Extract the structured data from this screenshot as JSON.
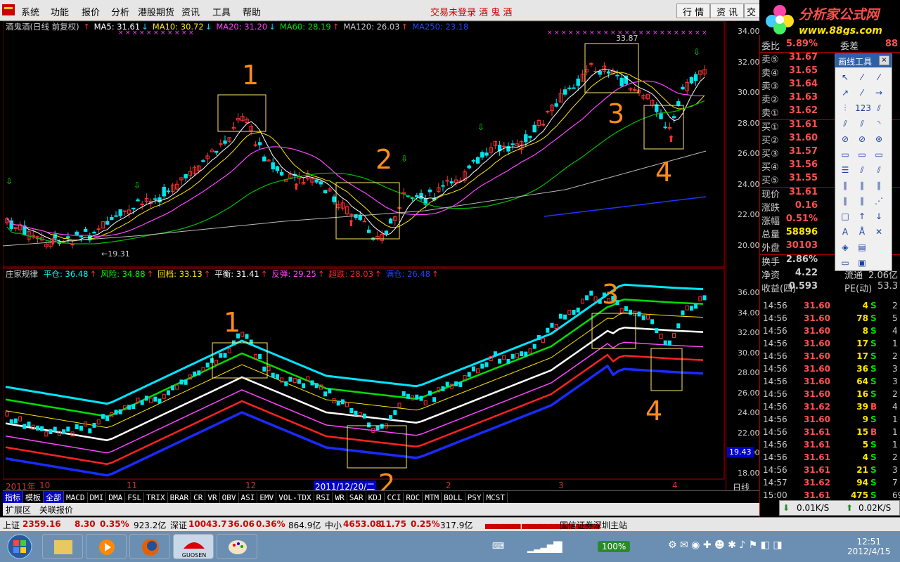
{
  "menubar": {
    "items": [
      "系统",
      "功能",
      "报价",
      "分析",
      "港股期货",
      "资讯",
      "工具",
      "帮助"
    ],
    "notice": "交易未登录  酒 鬼 酒",
    "tabs": [
      "行 情",
      "资 讯",
      "交"
    ]
  },
  "brand": {
    "name": "分析家公式网",
    "url": "www.88gs.com"
  },
  "main_chart": {
    "legend": {
      "stock": "酒鬼酒(日线 前复权)",
      "ma": [
        {
          "label": "MA5: 31.61",
          "color": "#ffffff",
          "arrow": "↓"
        },
        {
          "label": "MA10: 30.72",
          "color": "#ffe600",
          "arrow": "↓"
        },
        {
          "label": "MA20: 31.20",
          "color": "#ff44ff",
          "arrow": "↓"
        },
        {
          "label": "MA60: 28.19",
          "color": "#00dd00",
          "arrow": "↑"
        },
        {
          "label": "MA120: 26.03",
          "color": "#cccccc",
          "arrow": "↑"
        },
        {
          "label": "MA250: 23.18",
          "color": "#2244ff",
          "arrow": ""
        }
      ]
    },
    "price_axis": [
      "34.00",
      "32.00",
      "30.00",
      "28.00",
      "26.00",
      "24.00",
      "22.00",
      "20.00"
    ],
    "annotations": [
      "1",
      "2",
      "3",
      "4"
    ],
    "labels": {
      "high": "33.87",
      "low": "19.31"
    }
  },
  "sub_chart": {
    "legend": [
      {
        "label": "庄家规律",
        "color": "#cccccc"
      },
      {
        "label": "平仓: 36.48",
        "color": "#00ffff",
        "arrow": "↑"
      },
      {
        "label": "风险: 34.88",
        "color": "#00ff00",
        "arrow": "↑"
      },
      {
        "label": "回档: 33.13",
        "color": "#ffe600",
        "arrow": "↑"
      },
      {
        "label": "平衡: 31.41",
        "color": "#ffffff",
        "arrow": "↑"
      },
      {
        "label": "反弹: 29.25",
        "color": "#ff44ff",
        "arrow": "↑"
      },
      {
        "label": "超跌: 28.03",
        "color": "#ff2222",
        "arrow": "↑"
      },
      {
        "label": "满仓: 26.48",
        "color": "#2244ff",
        "arrow": "↑"
      }
    ],
    "price_axis": [
      "36.00",
      "34.00",
      "32.00",
      "30.00",
      "28.00",
      "26.00",
      "24.00",
      "22.00",
      "20.00",
      "18.00"
    ],
    "price_box": "19.43",
    "annotations": [
      "1",
      "2",
      "3",
      "4"
    ]
  },
  "time_axis": {
    "labels": [
      "2011年",
      "10",
      "11",
      "12",
      "2011/12/20/二",
      "2",
      "3",
      "4"
    ],
    "period": "日线"
  },
  "indicator_tabs": [
    "指标",
    "模板",
    "全部",
    "MACD",
    "DMI",
    "DMA",
    "FSL",
    "TRIX",
    "BRAR",
    "CR",
    "VR",
    "OBV",
    "ASI",
    "EMV",
    "VOL-TDX",
    "RSI",
    "WR",
    "SAR",
    "KDJ",
    "CCI",
    "ROC",
    "MTM",
    "BOLL",
    "PSY",
    "MCST"
  ],
  "sub_tabs": [
    "扩展区",
    "关联报价"
  ],
  "quote": {
    "weibi": {
      "label": "委比",
      "value": "5.89%",
      "extra": "委差",
      "extra_val": "88"
    },
    "sell": [
      {
        "label": "卖⑤",
        "price": "31.67"
      },
      {
        "label": "卖④",
        "price": "31.65"
      },
      {
        "label": "卖③",
        "price": "31.64"
      },
      {
        "label": "卖②",
        "price": "31.63"
      },
      {
        "label": "卖①",
        "price": "31.62"
      }
    ],
    "buy": [
      {
        "label": "买①",
        "price": "31.61"
      },
      {
        "label": "买②",
        "price": "31.60"
      },
      {
        "label": "买③",
        "price": "31.57"
      },
      {
        "label": "买④",
        "price": "31.56"
      },
      {
        "label": "买⑤",
        "price": "31.55"
      }
    ],
    "stats": [
      {
        "label": "现价",
        "value": "31.61",
        "color": "#ff5050"
      },
      {
        "label": "涨跌",
        "value": "0.16",
        "color": "#ff5050"
      },
      {
        "label": "涨幅",
        "value": "0.51%",
        "color": "#ff5050"
      },
      {
        "label": "总量",
        "value": "58896",
        "color": "#ffe600"
      },
      {
        "label": "外盘",
        "value": "30103",
        "color": "#ff5050"
      }
    ],
    "stats2": [
      {
        "label": "换手",
        "value": "2.86%"
      },
      {
        "label": "净资",
        "value": "4.22",
        "extra": "流通",
        "extra_val": "2.06亿"
      },
      {
        "label": "收益(四)",
        "value": "0.593",
        "extra": "PE(动)",
        "extra_val": "53.3"
      }
    ]
  },
  "ticks": [
    {
      "t": "14:56",
      "p": "31.60",
      "q": "4",
      "s": "S",
      "x": "2"
    },
    {
      "t": "14:56",
      "p": "31.60",
      "q": "78",
      "s": "S",
      "x": "5"
    },
    {
      "t": "14:56",
      "p": "31.60",
      "q": "8",
      "s": "S",
      "x": "4"
    },
    {
      "t": "14:56",
      "p": "31.60",
      "q": "17",
      "s": "S",
      "x": "1"
    },
    {
      "t": "14:56",
      "p": "31.60",
      "q": "17",
      "s": "S",
      "x": "2"
    },
    {
      "t": "14:56",
      "p": "31.60",
      "q": "36",
      "s": "S",
      "x": "3"
    },
    {
      "t": "14:56",
      "p": "31.60",
      "q": "64",
      "s": "S",
      "x": "3"
    },
    {
      "t": "14:56",
      "p": "31.60",
      "q": "16",
      "s": "S",
      "x": "2"
    },
    {
      "t": "14:56",
      "p": "31.62",
      "q": "39",
      "s": "B",
      "x": "4"
    },
    {
      "t": "14:56",
      "p": "31.60",
      "q": "9",
      "s": "S",
      "x": "1"
    },
    {
      "t": "14:56",
      "p": "31.61",
      "q": "15",
      "s": "B",
      "x": "1"
    },
    {
      "t": "14:56",
      "p": "31.61",
      "q": "5",
      "s": "S",
      "x": "1"
    },
    {
      "t": "14:56",
      "p": "31.61",
      "q": "4",
      "s": "S",
      "x": "2"
    },
    {
      "t": "14:56",
      "p": "31.61",
      "q": "21",
      "s": "S",
      "x": "3"
    },
    {
      "t": "14:57",
      "p": "31.62",
      "q": "94",
      "s": "S",
      "x": "7"
    },
    {
      "t": "15:00",
      "p": "31.61",
      "q": "475",
      "s": "S",
      "x": "69"
    }
  ],
  "drawing_tool": {
    "title": "画线工具",
    "close": "×"
  },
  "network": {
    "down": "0.01K/S",
    "up": "0.02K/S"
  },
  "statusbar": {
    "sh": {
      "name": "上证",
      "index": "2359.16",
      "chg": "8.30",
      "pct": "0.35%",
      "amt": "923.2亿"
    },
    "sz": {
      "name": "深证",
      "index": "10043.7",
      "chg": "36.06",
      "pct": "0.36%",
      "amt": "864.9亿"
    },
    "zx": {
      "name": "中小",
      "index": "4653.08",
      "chg": "11.75",
      "pct": "0.25%",
      "amt": "317.9亿"
    },
    "broker": "国信证券深圳主站"
  },
  "taskbar": {
    "battery": "100%",
    "time": "12:51",
    "date": "2012/4/15"
  }
}
